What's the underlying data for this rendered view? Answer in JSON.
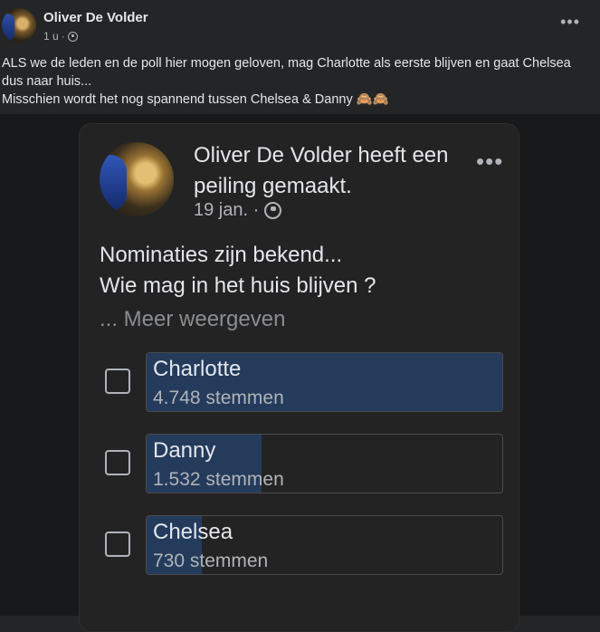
{
  "post": {
    "author": "Oliver De Volder",
    "time": "1 u",
    "separator": "·",
    "more_icon": "•••",
    "text_line1": "ALS we de leden en de poll hier mogen geloven, mag Charlotte als eerste blijven en gaat Chelsea dus naar huis...",
    "text_line2": "Misschien wordt het nog spannend tussen Chelsea & Danny 🙈🙈"
  },
  "poll_card": {
    "title": "Oliver De Volder heeft een peiling gemaakt.",
    "date": "19 jan. ·",
    "more_icon": "•••",
    "question_line1": "Nominaties zijn bekend...",
    "question_line2": "Wie mag in het huis blijven ?",
    "see_more": "... Meer weergeven",
    "options": [
      {
        "name": "Charlotte",
        "votes": "4.748 stemmen",
        "fill": 1.0
      },
      {
        "name": "Danny",
        "votes": "1.532 stemmen",
        "fill": 0.323
      },
      {
        "name": "Chelsea",
        "votes": "730 stemmen",
        "fill": 0.154
      }
    ]
  }
}
